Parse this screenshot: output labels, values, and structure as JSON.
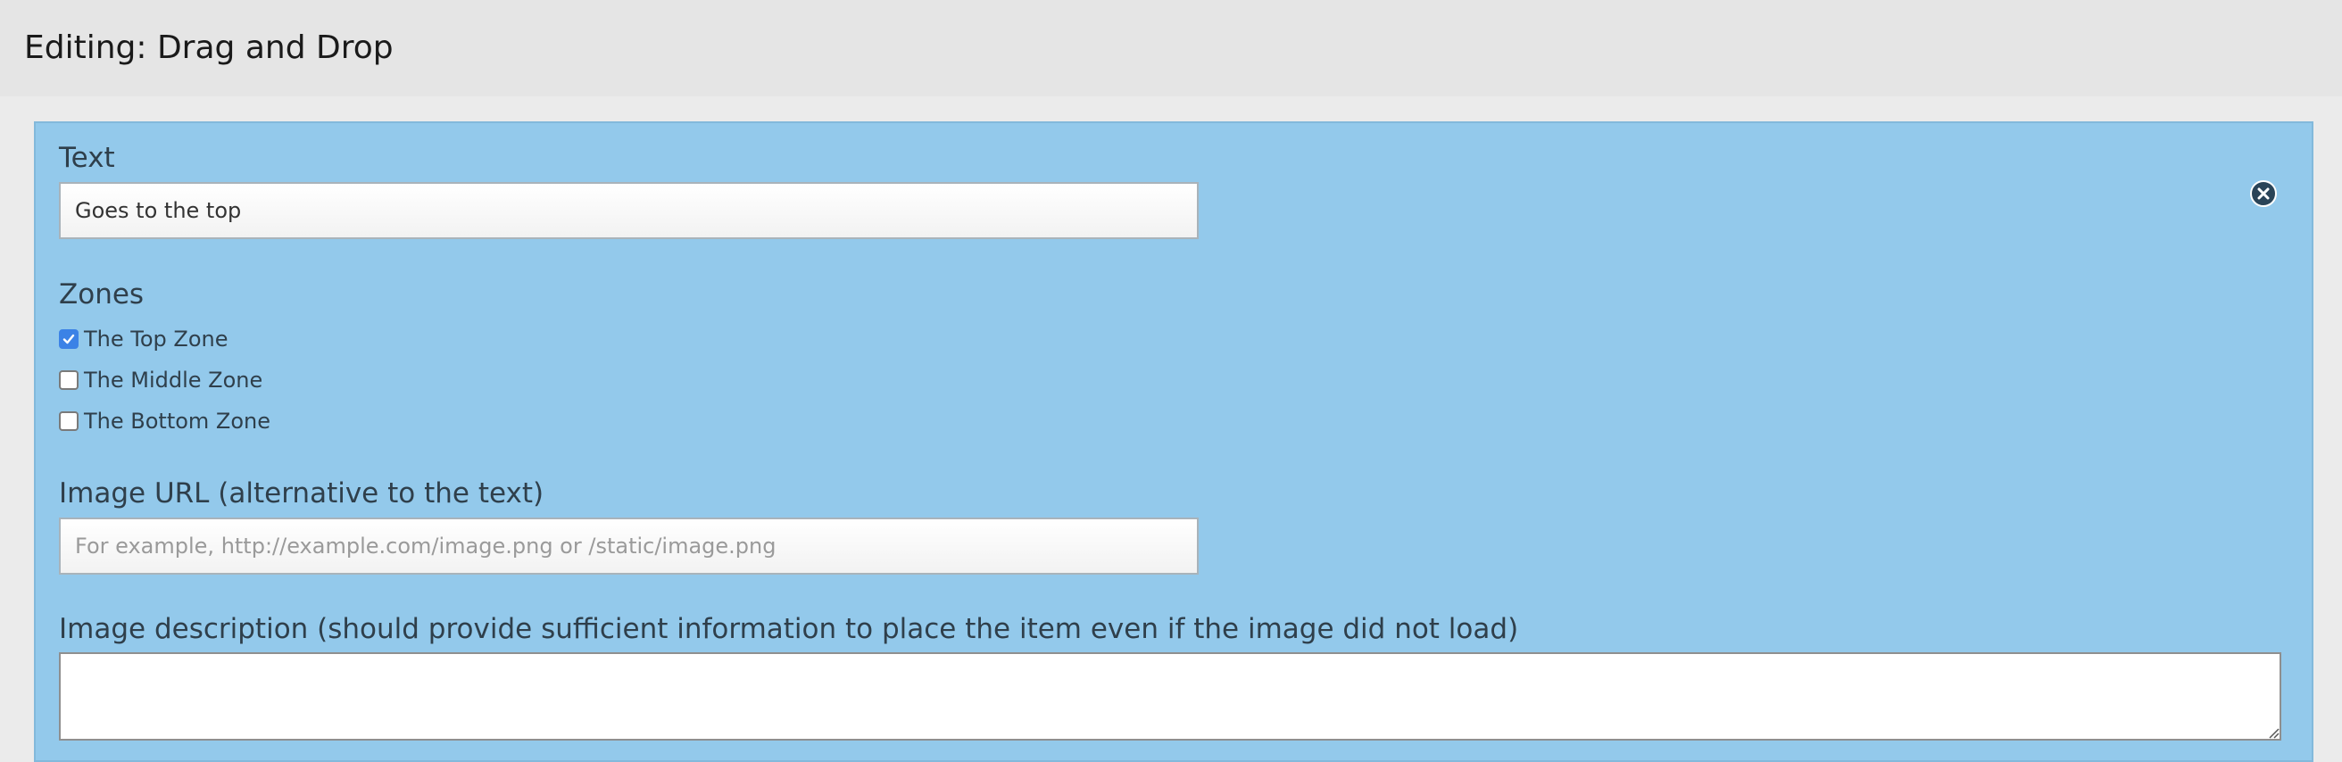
{
  "header": {
    "title": "Editing: Drag and Drop"
  },
  "item": {
    "text_label": "Text",
    "text_value": "Goes to the top",
    "zones_label": "Zones",
    "zones": [
      {
        "label": "The Top Zone",
        "checked": true
      },
      {
        "label": "The Middle Zone",
        "checked": false
      },
      {
        "label": "The Bottom Zone",
        "checked": false
      }
    ],
    "image_url_label": "Image URL (alternative to the text)",
    "image_url_placeholder": "For example, http://example.com/image.png or /static/image.png",
    "image_url_value": "",
    "image_description_label": "Image description (should provide sufficient information to place the item even if the image did not load)",
    "image_description_value": ""
  },
  "icons": {
    "remove": "close-circle-icon",
    "check": "check-icon",
    "resize": "resize-grip-icon"
  },
  "colors": {
    "panel_background": "#93c9eb",
    "header_background": "#e5e5e5",
    "checkbox_checked": "#3b82e6",
    "remove_button": "#2a4458"
  }
}
